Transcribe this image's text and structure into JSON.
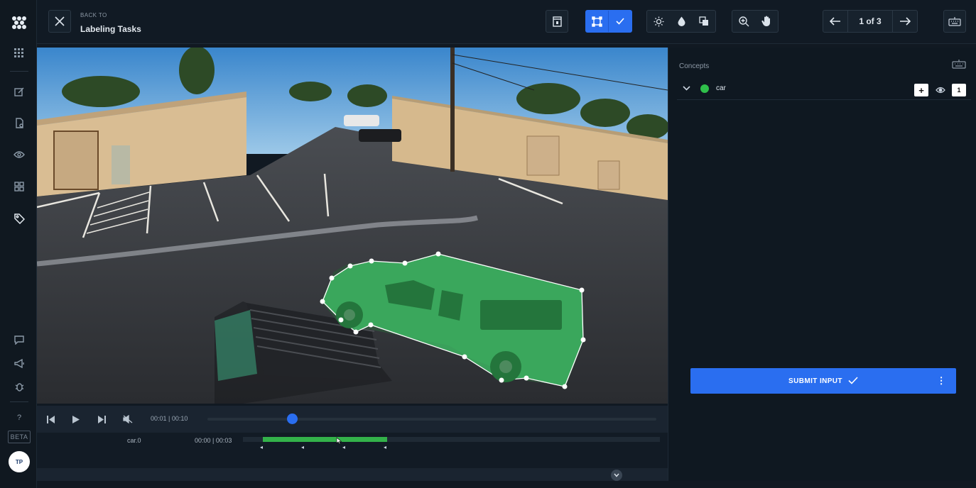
{
  "header": {
    "back_to": "BACK TO",
    "back_title": "Labeling Tasks",
    "page": "1 of 3"
  },
  "player": {
    "time": "00:01 | 00:10"
  },
  "track": {
    "label": "car.0",
    "time": "00:00 | 00:03"
  },
  "panel": {
    "title": "Concepts",
    "concepts": [
      {
        "name": "car",
        "color": "#2fbf4a",
        "count": "1"
      }
    ],
    "submit_label": "SUBMIT INPUT"
  },
  "user": {
    "initials": "TP",
    "beta": "BETA"
  },
  "colors": {
    "accent": "#2a6ef0",
    "polygon": "#3ecb6a",
    "track_fill": "#33b24a"
  }
}
